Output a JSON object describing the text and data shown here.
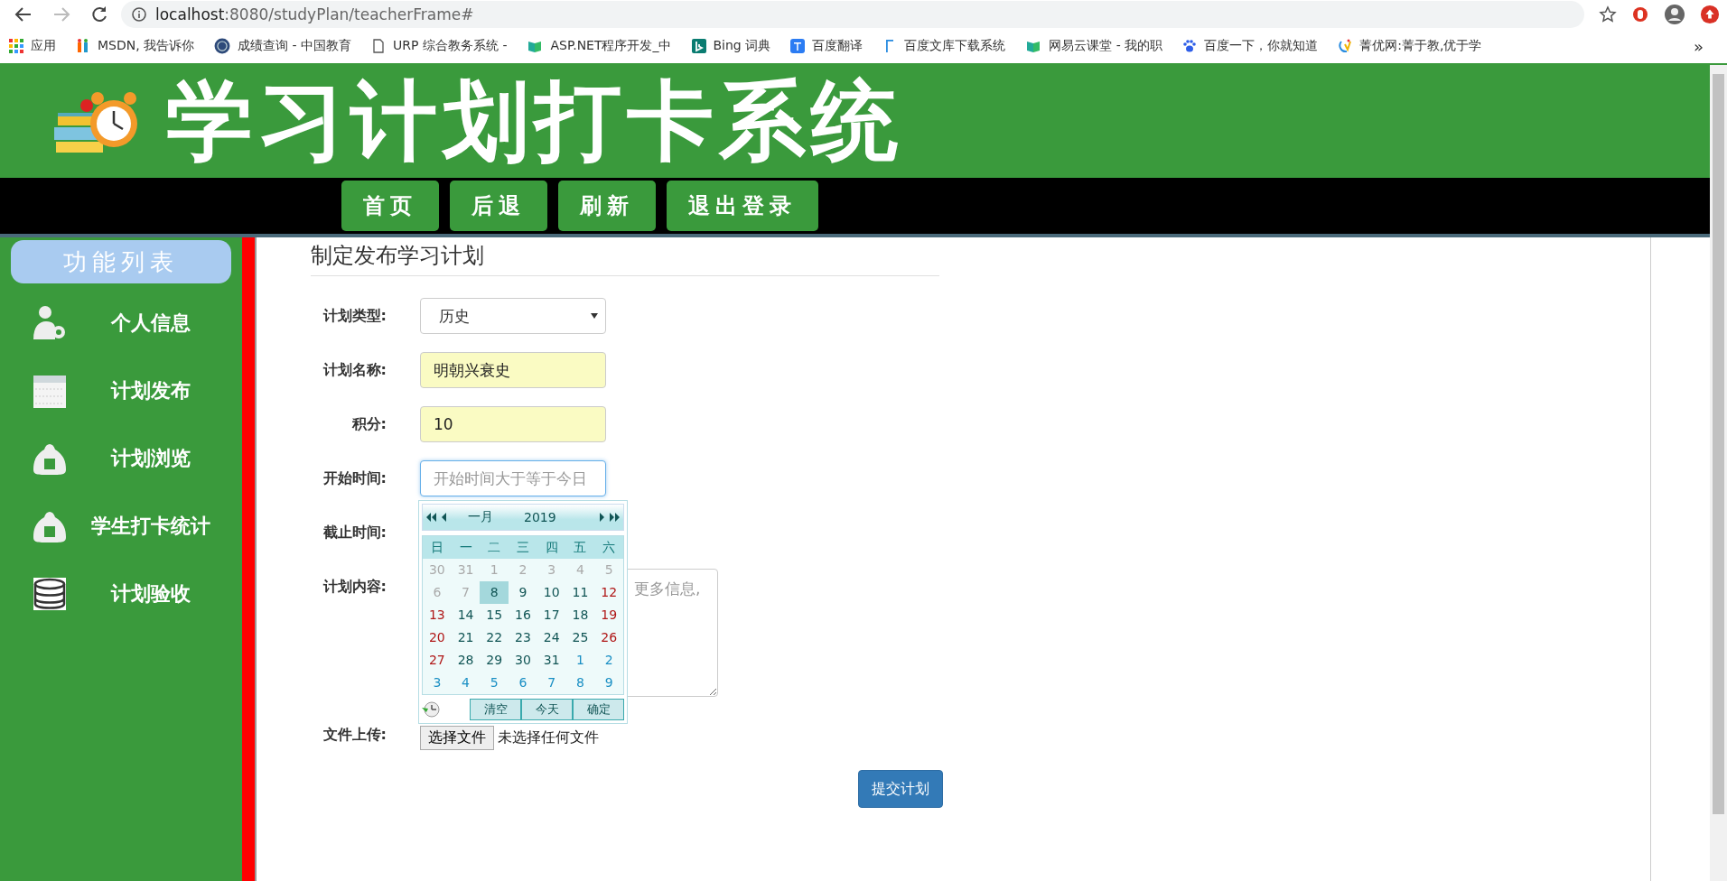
{
  "browser": {
    "url": {
      "host": "localhost",
      "path": ":8080/studyPlan/teacherFrame#"
    },
    "bookmarks": [
      {
        "label": "应用",
        "kind": "apps"
      },
      {
        "label": "MSDN, 我告诉你",
        "kind": "msdn"
      },
      {
        "label": "成绩查询 - 中国教育",
        "kind": "seal"
      },
      {
        "label": "URP 综合教务系统 -",
        "kind": "page"
      },
      {
        "label": "ASP.NET程序开发_中",
        "kind": "book"
      },
      {
        "label": "Bing 词典",
        "kind": "bing"
      },
      {
        "label": "百度翻译",
        "kind": "translate"
      },
      {
        "label": "百度文库下载系统",
        "kind": "bar"
      },
      {
        "label": "网易云课堂 - 我的职",
        "kind": "book"
      },
      {
        "label": "百度一下，你就知道",
        "kind": "paw"
      },
      {
        "label": "菁优网:菁于教,优于学",
        "kind": "swirl"
      }
    ],
    "more": "»"
  },
  "header": {
    "title": "学习计划打卡系统",
    "nav": [
      {
        "label": "首页"
      },
      {
        "label": "后退"
      },
      {
        "label": "刷新"
      },
      {
        "label": "退出登录"
      }
    ]
  },
  "sidebar": {
    "title": "功能列表",
    "items": [
      {
        "label": "个人信息",
        "kind": "user"
      },
      {
        "label": "计划发布",
        "kind": "calendar"
      },
      {
        "label": "计划浏览",
        "kind": "bag"
      },
      {
        "label": "学生打卡统计",
        "kind": "bag"
      },
      {
        "label": "计划验收",
        "kind": "database"
      }
    ]
  },
  "form": {
    "title": "制定发布学习计划",
    "fields": [
      {
        "label": "计划类型:",
        "kind": "select",
        "value": "历史"
      },
      {
        "label": "计划名称:",
        "kind": "text",
        "value": "明朝兴衰史"
      },
      {
        "label": "积分:",
        "kind": "text",
        "value": "10"
      },
      {
        "label": "开始时间:",
        "kind": "date",
        "placeholder": "开始时间大于等于今日"
      },
      {
        "label": "截止时间:",
        "kind": "hidden"
      },
      {
        "label": "计划内容:",
        "kind": "textarea",
        "placeholder": "更多信息,"
      },
      {
        "label": "文件上传:",
        "kind": "file",
        "button": "选择文件",
        "value": "未选择任何文件"
      }
    ],
    "submit": "提交计划"
  },
  "datepicker": {
    "month": "一月",
    "year": "2019",
    "weekdays": [
      "日",
      "一",
      "二",
      "三",
      "四",
      "五",
      "六"
    ],
    "days": [
      {
        "day": "30",
        "kind": "other",
        "selected": false
      },
      {
        "day": "31",
        "kind": "other",
        "selected": false
      },
      {
        "day": "1",
        "kind": "other",
        "selected": false
      },
      {
        "day": "2",
        "kind": "other",
        "selected": false
      },
      {
        "day": "3",
        "kind": "other",
        "selected": false
      },
      {
        "day": "4",
        "kind": "other",
        "selected": false
      },
      {
        "day": "5",
        "kind": "other",
        "selected": false
      },
      {
        "day": "6",
        "kind": "other",
        "selected": false
      },
      {
        "day": "7",
        "kind": "other",
        "selected": false
      },
      {
        "day": "8",
        "kind": "normal",
        "selected": true
      },
      {
        "day": "9",
        "kind": "normal",
        "selected": false
      },
      {
        "day": "10",
        "kind": "normal",
        "selected": false
      },
      {
        "day": "11",
        "kind": "normal",
        "selected": false
      },
      {
        "day": "12",
        "kind": "weekend",
        "selected": false
      },
      {
        "day": "13",
        "kind": "weekend",
        "selected": false
      },
      {
        "day": "14",
        "kind": "normal",
        "selected": false
      },
      {
        "day": "15",
        "kind": "normal",
        "selected": false
      },
      {
        "day": "16",
        "kind": "normal",
        "selected": false
      },
      {
        "day": "17",
        "kind": "normal",
        "selected": false
      },
      {
        "day": "18",
        "kind": "normal",
        "selected": false
      },
      {
        "day": "19",
        "kind": "weekend",
        "selected": false
      },
      {
        "day": "20",
        "kind": "weekend",
        "selected": false
      },
      {
        "day": "21",
        "kind": "normal",
        "selected": false
      },
      {
        "day": "22",
        "kind": "normal",
        "selected": false
      },
      {
        "day": "23",
        "kind": "normal",
        "selected": false
      },
      {
        "day": "24",
        "kind": "normal",
        "selected": false
      },
      {
        "day": "25",
        "kind": "normal",
        "selected": false
      },
      {
        "day": "26",
        "kind": "weekend",
        "selected": false
      },
      {
        "day": "27",
        "kind": "weekend",
        "selected": false
      },
      {
        "day": "28",
        "kind": "normal",
        "selected": false
      },
      {
        "day": "29",
        "kind": "normal",
        "selected": false
      },
      {
        "day": "30",
        "kind": "normal",
        "selected": false
      },
      {
        "day": "31",
        "kind": "normal",
        "selected": false
      },
      {
        "day": "1",
        "kind": "next",
        "selected": false
      },
      {
        "day": "2",
        "kind": "next",
        "selected": false
      },
      {
        "day": "3",
        "kind": "next",
        "selected": false
      },
      {
        "day": "4",
        "kind": "next",
        "selected": false
      },
      {
        "day": "5",
        "kind": "next",
        "selected": false
      },
      {
        "day": "6",
        "kind": "next",
        "selected": false
      },
      {
        "day": "7",
        "kind": "next",
        "selected": false
      },
      {
        "day": "8",
        "kind": "next",
        "selected": false
      },
      {
        "day": "9",
        "kind": "next",
        "selected": false
      }
    ],
    "buttons": [
      "清空",
      "今天",
      "确定"
    ]
  }
}
